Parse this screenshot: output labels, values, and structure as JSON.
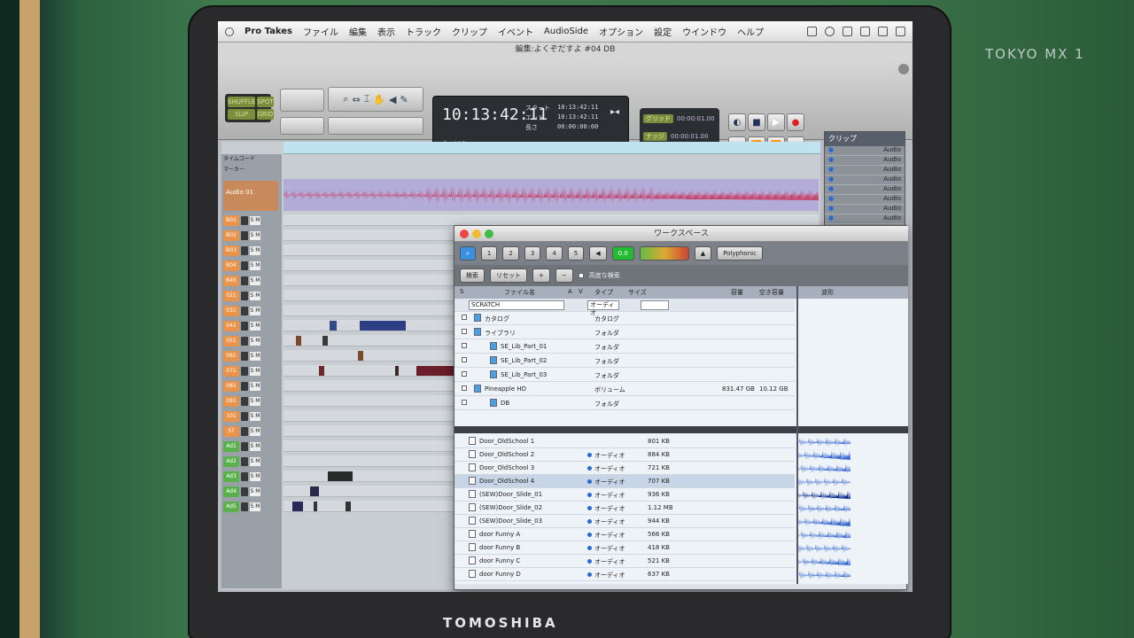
{
  "broadcast_logo": "TOKYO MX 1",
  "monitor_brand": "TOMOSHIBA",
  "menu": {
    "app": "Pro Takes",
    "items": [
      "ファイル",
      "編集",
      "表示",
      "トラック",
      "クリップ",
      "イベント",
      "AudioSide",
      "オプション",
      "設定",
      "ウインドウ",
      "ヘルプ"
    ]
  },
  "doc_title": "編集:よくぞだすよ #04 DB",
  "modes": [
    "SHUFFLE",
    "SPOT",
    "SLIP",
    "GRID"
  ],
  "counter": {
    "main": "10:13:42:11",
    "start_label": "スタート",
    "end_label": "エンド",
    "length_label": "長さ",
    "start": "10:13:42:11",
    "end": "10:13:42:11",
    "length": "00:00:00:00",
    "cursor_label": "カーソル"
  },
  "grid": {
    "grid_label": "グリッド",
    "grid_value": "00:00:01.00",
    "nudge_label": "ナッジ",
    "nudge_value": "00:00:01.00"
  },
  "clips": {
    "title": "クリップ",
    "items": [
      "Audio",
      "Audio",
      "Audio",
      "Audio",
      "Audio",
      "Audio",
      "Audio",
      "Audio"
    ]
  },
  "tracks": {
    "ruler1": "タイムコード",
    "ruler2": "マーカー",
    "audio": "Audio 01",
    "names": [
      "B01",
      "B02",
      "B03",
      "B04",
      "B45",
      "021",
      "031",
      "041",
      "051",
      "061",
      "071",
      "081",
      "091",
      "101",
      "ST",
      "Ad1",
      "Ad2",
      "Ad3",
      "Ad4",
      "Ad5"
    ]
  },
  "workspace": {
    "title": "ワークスペース",
    "tabs": [
      "1",
      "2",
      "3",
      "4",
      "5"
    ],
    "zoom": "0.0",
    "mode": "Polyphonic",
    "search_btn": "検索",
    "reset_btn": "リセット",
    "advanced": "高度な検索",
    "col_name": "ファイル名",
    "col_a": "A",
    "col_v": "V",
    "col_type": "タイプ",
    "col_size": "サイズ",
    "col_capacity": "容量",
    "col_free": "空き容量",
    "col_wave": "波形",
    "filter_name": "SCRATCH",
    "filter_type": "オーディオ",
    "top_rows": [
      {
        "name": "カタログ",
        "type": "カタログ",
        "cap": "",
        "free": ""
      },
      {
        "name": "ライブラリ",
        "type": "フォルダ",
        "cap": "",
        "free": ""
      },
      {
        "name": "SE_Lib_Part_01",
        "type": "フォルダ",
        "cap": "",
        "free": ""
      },
      {
        "name": "SE_Lib_Part_02",
        "type": "フォルダ",
        "cap": "",
        "free": ""
      },
      {
        "name": "SE_Lib_Part_03",
        "type": "フォルダ",
        "cap": "",
        "free": ""
      },
      {
        "name": "Pineapple HD",
        "type": "ボリューム",
        "cap": "831.47 GB",
        "free": "10.12 GB"
      },
      {
        "name": "DB",
        "type": "フォルダ",
        "cap": "",
        "free": ""
      }
    ],
    "files": [
      {
        "name": "Door_OldSchool 1",
        "type": "",
        "size": "801 KB"
      },
      {
        "name": "Door_OldSchool 2",
        "type": "オーディオ",
        "size": "884 KB"
      },
      {
        "name": "Door_OldSchool 3",
        "type": "オーディオ",
        "size": "721 KB"
      },
      {
        "name": "Door_OldSchool 4",
        "type": "オーディオ",
        "size": "707 KB"
      },
      {
        "name": "(SEW)Door_Slide_01",
        "type": "オーディオ",
        "size": "936 KB"
      },
      {
        "name": "(SEW)Door_Slide_02",
        "type": "オーディオ",
        "size": "1.12 MB"
      },
      {
        "name": "(SEW)Door_Slide_03",
        "type": "オーディオ",
        "size": "944 KB"
      },
      {
        "name": "door Funny A",
        "type": "オーディオ",
        "size": "566 KB"
      },
      {
        "name": "door Funny B",
        "type": "オーディオ",
        "size": "418 KB"
      },
      {
        "name": "door Funny C",
        "type": "オーディオ",
        "size": "521 KB"
      },
      {
        "name": "door Funny D",
        "type": "オーディオ",
        "size": "637 KB"
      }
    ]
  }
}
